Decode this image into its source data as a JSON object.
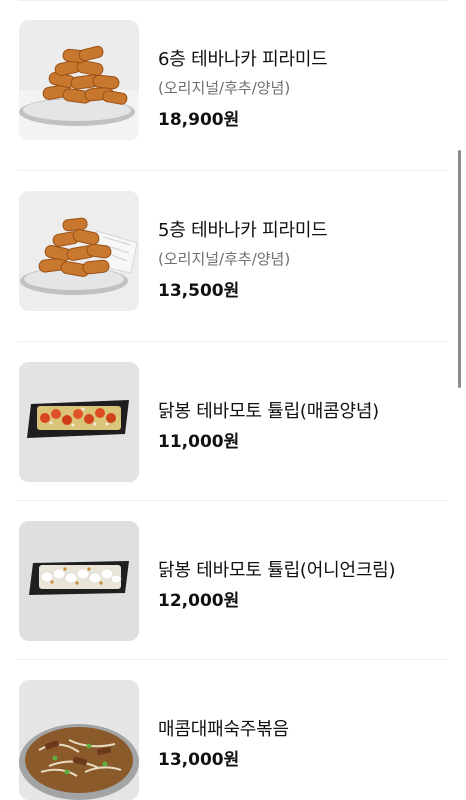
{
  "menu": {
    "items": [
      {
        "name": "6층 테바나카 피라미드",
        "desc": "(오리지널/후추/양념)",
        "price": "18,900원",
        "image": "fried-chicken-wings-pyramid-6"
      },
      {
        "name": "5층 테바나카 피라미드",
        "desc": "(오리지널/후추/양념)",
        "price": "13,500원",
        "image": "fried-chicken-wings-pyramid-5"
      },
      {
        "name": "닭봉 테바모토 튤립(매콤양념)",
        "price": "11,000원",
        "image": "spicy-drumstick-tulip"
      },
      {
        "name": "닭봉 테바모토 튤립(어니언크림)",
        "price": "12,000원",
        "image": "onion-cream-drumstick-tulip"
      },
      {
        "name": "매콤대패숙주볶음",
        "price": "13,000원",
        "image": "spicy-pork-bean-sprout-stirfry"
      }
    ]
  }
}
